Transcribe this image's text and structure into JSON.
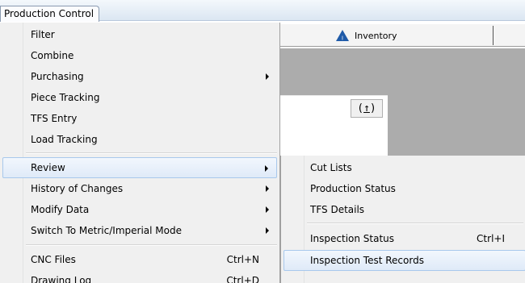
{
  "menubar": {
    "active_menu": "Production Control"
  },
  "toolbar": {
    "inventory_tab": "Inventory",
    "up_button": "↑"
  },
  "menu": {
    "items": [
      {
        "label": "Filter"
      },
      {
        "label": "Combine"
      },
      {
        "label": "Purchasing",
        "submenu": true
      },
      {
        "label": "Piece Tracking"
      },
      {
        "label": "TFS Entry"
      },
      {
        "label": "Load Tracking"
      },
      {
        "label": "Review",
        "submenu": true,
        "highlighted": true
      },
      {
        "label": "History of Changes",
        "submenu": true
      },
      {
        "label": "Modify Data",
        "submenu": true
      },
      {
        "label": "Switch To Metric/Imperial Mode",
        "submenu": true
      },
      {
        "label": "CNC Files",
        "shortcut": "Ctrl+N"
      },
      {
        "label": "Drawing Log",
        "shortcut": "Ctrl+D"
      }
    ]
  },
  "submenu": {
    "items": [
      {
        "label": "Cut Lists"
      },
      {
        "label": "Production Status"
      },
      {
        "label": "TFS Details"
      },
      {
        "label": "Inspection Status",
        "shortcut": "Ctrl+I"
      },
      {
        "label": "Inspection Test Records",
        "highlighted": true
      }
    ]
  },
  "colors": {
    "highlight_border": "#a8c8ec",
    "menu_bg": "#f0f0f0",
    "panel_gray": "#acacac",
    "inventory_icon": "#1e5aa8"
  },
  "icons": {
    "inventory": "inventory-triangle-icon",
    "submenu_arrow": "chevron-right-icon"
  }
}
